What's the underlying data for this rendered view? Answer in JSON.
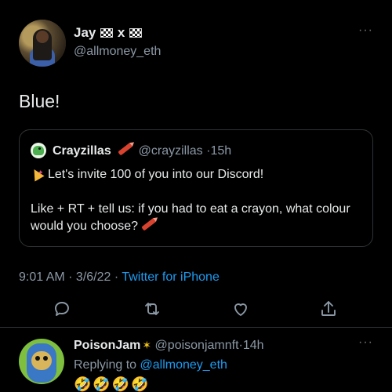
{
  "tweet": {
    "author_name": "Jay",
    "author_name_sep": "x",
    "handle": "@allmoney_eth",
    "text": "Blue!",
    "more_icon": "more-horizontal-icon",
    "quoted": {
      "name": "Crayzillas",
      "handle": "@crayzillas",
      "sep": "·",
      "age": "15h",
      "line1": "Let's invite 100 of you into our Discord!",
      "line2": "Like + RT + tell us: if you had to eat a crayon, what colour would you choose?"
    },
    "time": "9:01 AM",
    "date": "3/6/22",
    "source": "Twitter for iPhone",
    "actions": [
      {
        "name": "reply",
        "icon": "reply-icon"
      },
      {
        "name": "retweet",
        "icon": "retweet-icon"
      },
      {
        "name": "like",
        "icon": "heart-icon"
      },
      {
        "name": "share",
        "icon": "share-icon"
      }
    ]
  },
  "reply": {
    "name": "PoisonJam",
    "handle": "@poisonjamnft",
    "sep": "·",
    "age": "14h",
    "replying_prefix": "Replying to",
    "replying_to": "@allmoney_eth",
    "body": "🤣🤣🤣🤣"
  },
  "colors": {
    "background": "#000000",
    "text": "#e7e9ea",
    "muted": "#8b98a5",
    "accent": "#1d9bf0",
    "border": "#2f3336"
  }
}
